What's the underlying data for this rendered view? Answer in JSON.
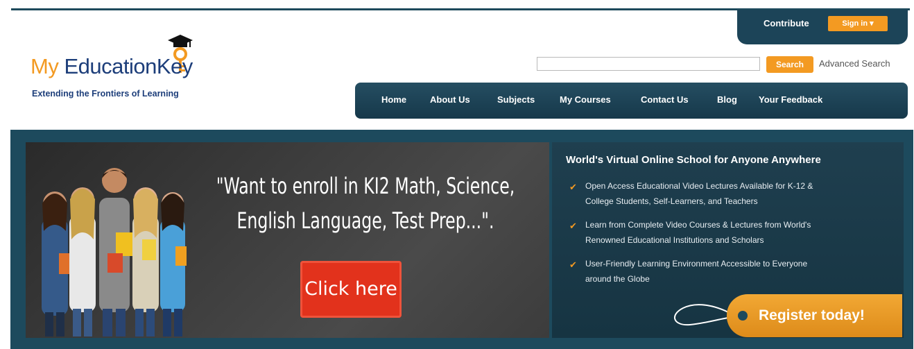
{
  "header": {
    "contribute_label": "Contribute",
    "signin_label": "Sign in  ▾",
    "logo": {
      "my": "My",
      "education": " Education",
      "key": "Key",
      "tagline": "Extending the Frontiers of Learning"
    },
    "search": {
      "value": "",
      "placeholder": "",
      "button_label": "Search",
      "advanced_label": "Advanced Search"
    }
  },
  "nav": {
    "items": [
      {
        "label": "Home"
      },
      {
        "label": "About Us"
      },
      {
        "label": "Subjects"
      },
      {
        "label": "My Courses"
      },
      {
        "label": "Contact Us"
      },
      {
        "label": "Blog"
      },
      {
        "label": "Your Feedback"
      }
    ]
  },
  "banner": {
    "promo_line1": "\"Want to enroll in KI2 Math, Science,",
    "promo_line2": "English Language, Test Prep...\".",
    "click_label": "Click here",
    "right_title": "World's Virtual Online School for Anyone Anywhere",
    "features": [
      {
        "line1": "Open Access Educational Video Lectures Available for K-12 &",
        "line2": "College Students, Self-Learners, and Teachers"
      },
      {
        "line1": "Learn from Complete Video Courses & Lectures from World's",
        "line2": "Renowned Educational Institutions and Scholars"
      },
      {
        "line1": "User-Friendly Learning Environment Accessible to Everyone",
        "line2": "around the Globe"
      }
    ],
    "register_label": "Register today!"
  },
  "colors": {
    "brand_orange": "#f39a22",
    "brand_navy": "#1d3e7a",
    "banner_teal": "#1d4a5d",
    "click_red": "#e2321c"
  },
  "icons": [
    "graduation-cap-key-icon",
    "checkmark-icon",
    "chevron-down-icon"
  ]
}
